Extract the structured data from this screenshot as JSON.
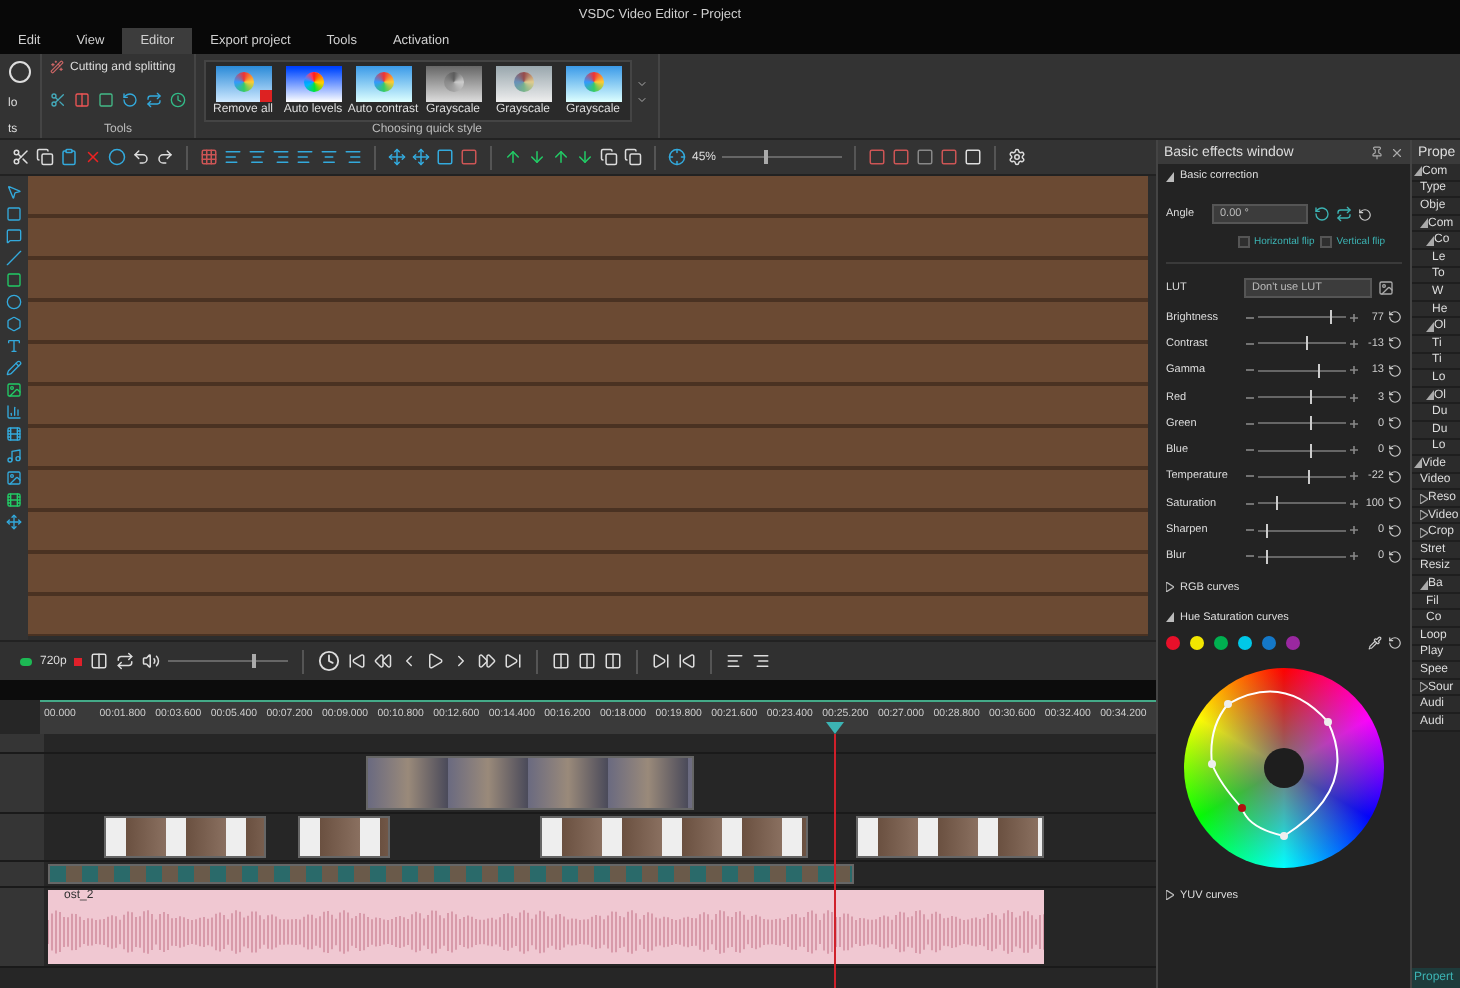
{
  "window": {
    "title": "VSDC Video Editor - Project"
  },
  "menu_tabs": [
    {
      "label": "Edit",
      "selected": false
    },
    {
      "label": "View",
      "selected": false
    },
    {
      "label": "Editor",
      "selected": true
    },
    {
      "label": "Export project",
      "selected": false
    },
    {
      "label": "Tools",
      "selected": false
    },
    {
      "label": "Activation",
      "selected": false
    }
  ],
  "ribbon": {
    "partial_button": [
      "lo",
      "ts"
    ],
    "tools_group": {
      "cutting_label": "Cutting and splitting",
      "group_label": "Tools"
    },
    "quick_style": {
      "group_label": "Choosing quick style",
      "styles": [
        {
          "label": "Remove all",
          "kind": "remove"
        },
        {
          "label": "Auto levels",
          "kind": "vivid"
        },
        {
          "label": "Auto contrast",
          "kind": "normal"
        },
        {
          "label": "Grayscale",
          "kind": "gray"
        },
        {
          "label": "Grayscale",
          "kind": "faded"
        },
        {
          "label": "Grayscale",
          "kind": "normal"
        }
      ]
    }
  },
  "toolbar": {
    "zoom": "45%",
    "zoom_slider": {
      "level": 0.35
    }
  },
  "playback": {
    "resolution": "720p",
    "volume": {
      "level": 0.7
    }
  },
  "timeline": {
    "ruler": [
      "00.000",
      "00:01.800",
      "00:03.600",
      "00:05.400",
      "00:07.200",
      "00:09.000",
      "00:10.800",
      "00:12.600",
      "00:14.400",
      "00:16.200",
      "00:18.000",
      "00:19.800",
      "00:21.600",
      "00:23.400",
      "00:25.200",
      "00:27.000",
      "00:28.800",
      "00:30.600",
      "00:32.400",
      "00:34.200"
    ],
    "audio_clip": "ost_2"
  },
  "effects_panel": {
    "title": "Basic effects window",
    "section": {
      "label": "Basic correction",
      "expanded": true
    },
    "angle": {
      "label": "Angle",
      "value": "0.00 °"
    },
    "flips": [
      {
        "label": "Horizontal flip",
        "checked": false
      },
      {
        "label": "Vertical flip",
        "checked": false
      }
    ],
    "lut": {
      "label": "LUT",
      "value": "Don't use LUT"
    },
    "sliders": [
      {
        "label": "Brightness",
        "value": "77",
        "level": 0.82
      },
      {
        "label": "Contrast",
        "value": "-13",
        "level": 0.55
      },
      {
        "label": "Gamma",
        "value": "13",
        "level": 0.68
      },
      {
        "label": "Red",
        "value": "3",
        "level": 0.6
      },
      {
        "label": "Green",
        "value": "0",
        "level": 0.6
      },
      {
        "label": "Blue",
        "value": "0",
        "level": 0.6
      },
      {
        "label": "Temperature",
        "value": "-22",
        "level": 0.56
      },
      {
        "label": "Saturation",
        "value": "100",
        "level": 0.2
      },
      {
        "label": "Sharpen",
        "value": "0",
        "level": 0.1
      },
      {
        "label": "Blur",
        "value": "0",
        "level": 0.1
      }
    ],
    "rgb_curves": {
      "label": "RGB curves",
      "expanded": false
    },
    "hue_curves": {
      "label": "Hue Saturation curves",
      "expanded": true,
      "swatches": [
        {
          "color": "#e8102a"
        },
        {
          "color": "#f2e600"
        },
        {
          "color": "#00b050"
        },
        {
          "color": "#00c8e8"
        },
        {
          "color": "#1478c8"
        },
        {
          "color": "#9a28a0"
        }
      ]
    },
    "yuv_curves": {
      "label": "YUV curves",
      "expanded": false
    }
  },
  "properties_panel": {
    "title": "Prope",
    "tree": [
      {
        "label": "Com",
        "expanded": true,
        "children": [
          {
            "label": "Type"
          },
          {
            "label": "Obje"
          },
          {
            "label": "Com",
            "expanded": true,
            "children": [
              {
                "label": "Co",
                "expanded": true,
                "children": [
                  {
                    "label": "Le"
                  },
                  {
                    "label": "To"
                  },
                  {
                    "label": "W"
                  },
                  {
                    "label": "He"
                  }
                ]
              },
              {
                "label": "Ol",
                "expanded": true,
                "children": [
                  {
                    "label": "Ti"
                  },
                  {
                    "label": "Ti"
                  },
                  {
                    "label": "Lo"
                  }
                ]
              },
              {
                "label": "Ol",
                "expanded": true,
                "children": [
                  {
                    "label": "Du"
                  },
                  {
                    "label": "Du"
                  },
                  {
                    "label": "Lo"
                  }
                ]
              }
            ]
          }
        ]
      },
      {
        "label": "Vide",
        "expanded": true,
        "children": [
          {
            "label": "Video"
          },
          {
            "label": "Reso",
            "expanded": false
          },
          {
            "label": "Video",
            "expanded": false
          },
          {
            "label": "Crop",
            "expanded": false
          },
          {
            "label": "Stret"
          },
          {
            "label": "Resiz"
          },
          {
            "label": "Ba",
            "expanded": true,
            "children": [
              {
                "label": "Fil"
              },
              {
                "label": "Co"
              }
            ]
          },
          {
            "label": "Loop"
          },
          {
            "label": "Play"
          },
          {
            "label": "Spee"
          },
          {
            "label": "Sour",
            "expanded": false
          },
          {
            "label": "Audi"
          },
          {
            "label": "Audi"
          }
        ]
      }
    ],
    "bottom_tab": "Propert"
  }
}
